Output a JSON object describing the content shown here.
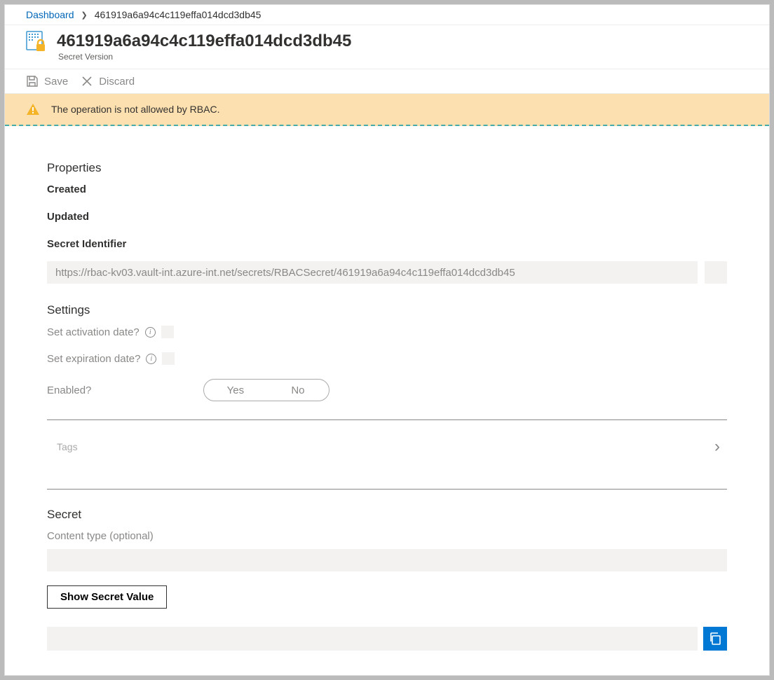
{
  "breadcrumb": {
    "root": "Dashboard",
    "current": "461919a6a94c4c119effa014dcd3db45"
  },
  "header": {
    "title": "461919a6a94c4c119effa014dcd3db45",
    "subtitle": "Secret Version"
  },
  "toolbar": {
    "save_label": "Save",
    "discard_label": "Discard"
  },
  "alert": {
    "message": "The operation is not allowed by RBAC."
  },
  "properties": {
    "section_title": "Properties",
    "created_label": "Created",
    "updated_label": "Updated",
    "secret_identifier_label": "Secret Identifier",
    "secret_identifier_value": "https://rbac-kv03.vault-int.azure-int.net/secrets/RBACSecret/461919a6a94c4c119effa014dcd3db45"
  },
  "settings": {
    "section_title": "Settings",
    "activation_label": "Set activation date?",
    "expiration_label": "Set expiration date?",
    "enabled_label": "Enabled?",
    "yes": "Yes",
    "no": "No",
    "tags_label": "Tags"
  },
  "secret": {
    "section_title": "Secret",
    "content_type_label": "Content type (optional)",
    "show_button": "Show Secret Value"
  },
  "icons": {
    "keyvault": "keyvault-secret-icon",
    "save": "save-icon",
    "close": "close-icon",
    "warning": "warning-icon",
    "copy": "copy-icon",
    "chevron_right": "chevron-right-icon",
    "info": "info-icon"
  }
}
